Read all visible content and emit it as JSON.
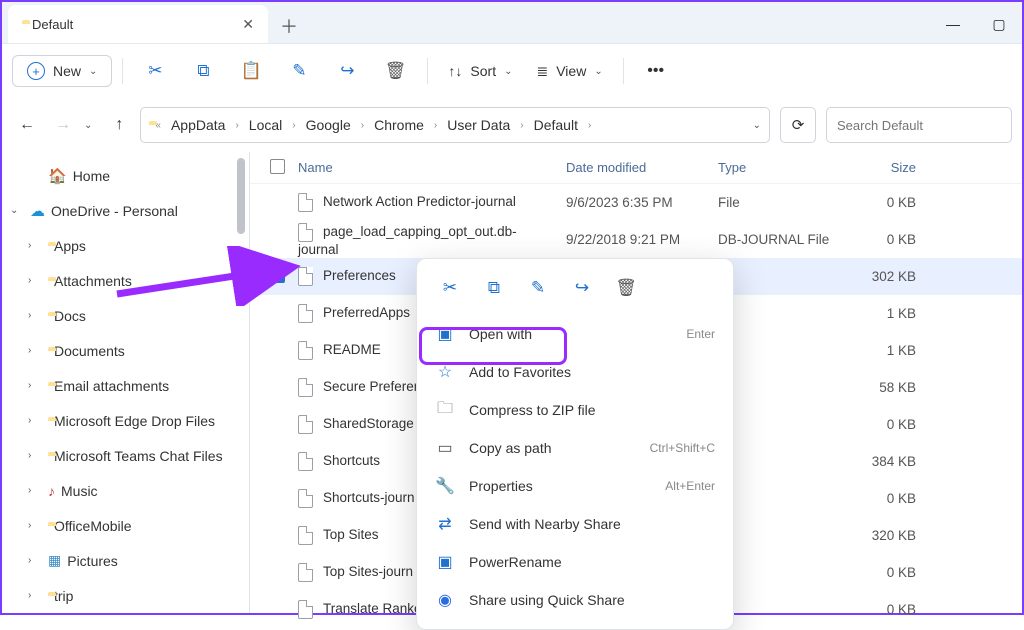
{
  "titlebar": {
    "tab_label": "Default"
  },
  "toolbar": {
    "new_label": "New",
    "sort_label": "Sort",
    "view_label": "View"
  },
  "breadcrumbs": {
    "c0": "AppData",
    "c1": "Local",
    "c2": "Google",
    "c3": "Chrome",
    "c4": "User Data",
    "c5": "Default"
  },
  "search_placeholder": "Search Default",
  "sidebar": {
    "home": "Home",
    "onedrive": "OneDrive - Personal",
    "items": [
      "Apps",
      "Attachments",
      "Docs",
      "Documents",
      "Email attachments",
      "Microsoft Edge Drop Files",
      "Microsoft Teams Chat Files",
      "Music",
      "OfficeMobile",
      "Pictures",
      "trip"
    ]
  },
  "columns": {
    "name": "Name",
    "date": "Date modified",
    "type": "Type",
    "size": "Size"
  },
  "rows": [
    {
      "name": "Network Action Predictor-journal",
      "date": "9/6/2023 6:35 PM",
      "type": "File",
      "size": "0 KB",
      "selected": false
    },
    {
      "name": "page_load_capping_opt_out.db-journal",
      "date": "9/22/2018 9:21 PM",
      "type": "DB-JOURNAL File",
      "size": "0 KB",
      "selected": false
    },
    {
      "name": "Preferences",
      "date": "",
      "type": "",
      "size": "302 KB",
      "selected": true
    },
    {
      "name": "PreferredApps",
      "date": "",
      "type": "",
      "size": "1 KB",
      "selected": false
    },
    {
      "name": "README",
      "date": "",
      "type": "",
      "size": "1 KB",
      "selected": false
    },
    {
      "name": "Secure Preferen",
      "date": "",
      "type": "",
      "size": "58 KB",
      "selected": false
    },
    {
      "name": "SharedStorage",
      "date": "",
      "type": "",
      "size": "0 KB",
      "selected": false
    },
    {
      "name": "Shortcuts",
      "date": "",
      "type": "",
      "size": "384 KB",
      "selected": false
    },
    {
      "name": "Shortcuts-journ",
      "date": "",
      "type": "",
      "size": "0 KB",
      "selected": false
    },
    {
      "name": "Top Sites",
      "date": "",
      "type": "",
      "size": "320 KB",
      "selected": false
    },
    {
      "name": "Top Sites-journ",
      "date": "",
      "type": "",
      "size": "0 KB",
      "selected": false
    },
    {
      "name": "Translate Ranke",
      "date": "",
      "type": "",
      "size": "0 KB",
      "selected": false
    }
  ],
  "ctx": {
    "open_with": "Open with",
    "open_with_sc": "Enter",
    "favorites": "Add to Favorites",
    "compress": "Compress to ZIP file",
    "copy_path": "Copy as path",
    "copy_path_sc": "Ctrl+Shift+C",
    "properties": "Properties",
    "properties_sc": "Alt+Enter",
    "nearby": "Send with Nearby Share",
    "power": "PowerRename",
    "quick": "Share using Quick Share"
  }
}
